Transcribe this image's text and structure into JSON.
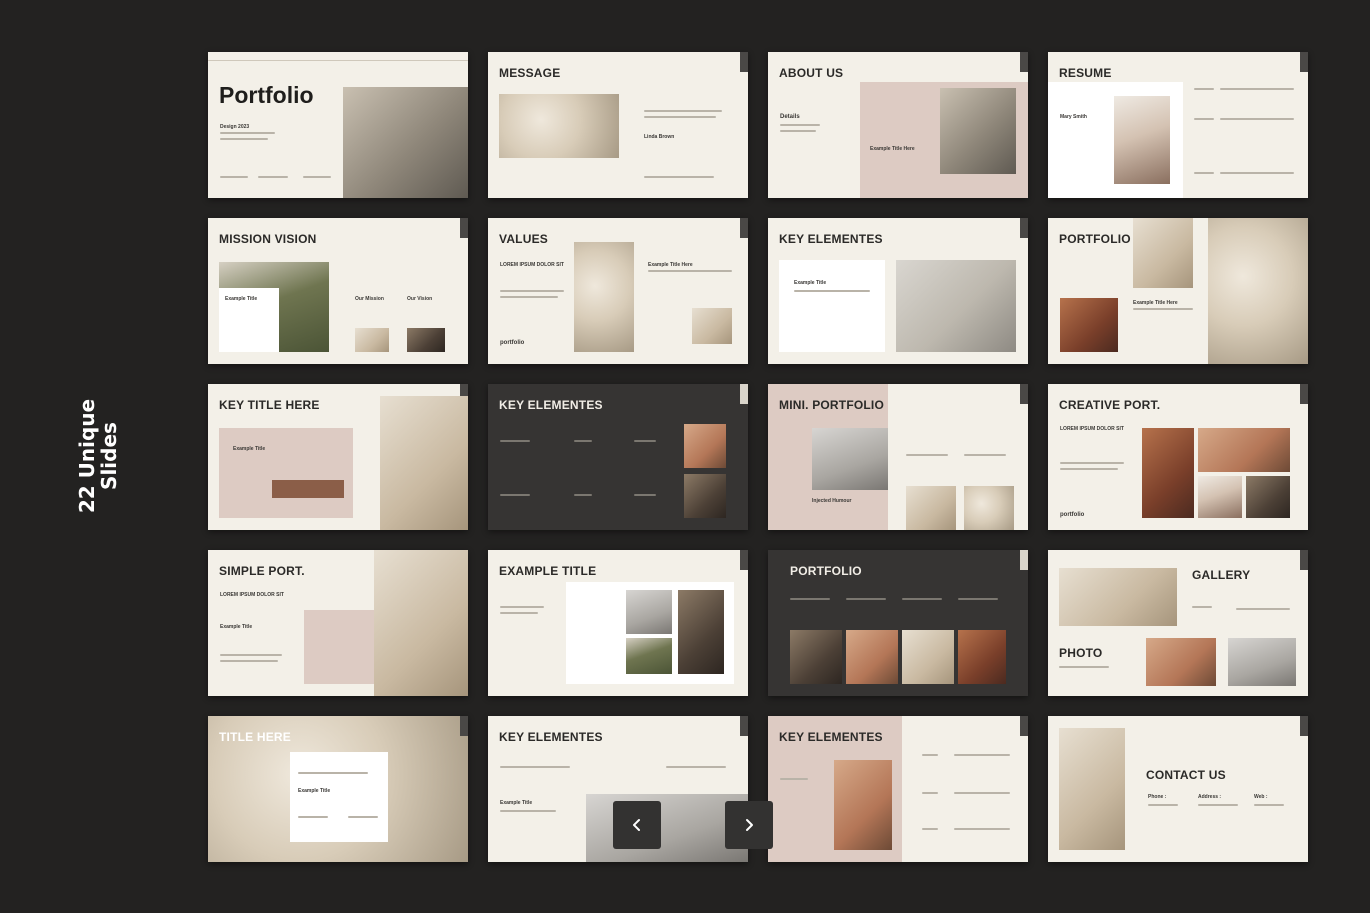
{
  "caption": {
    "line1": "22 Unique",
    "line2": "Slides"
  },
  "slides": [
    {
      "title": "Portfolio",
      "sub": "Design 2023"
    },
    {
      "title": "MESSAGE",
      "name": "Linda Brown"
    },
    {
      "title": "ABOUT US",
      "sub": "Details",
      "tag": "Example Title Here"
    },
    {
      "title": "RESUME",
      "name": "Mary Smith"
    },
    {
      "title": "MISSION VISION",
      "tag": "Example Title",
      "col1": "Our Mission",
      "col2": "Our Vision"
    },
    {
      "title": "VALUES",
      "sub": "LOREM IPSUM DOLOR SIT",
      "tag": "Example Title Here",
      "brand": "portfolio"
    },
    {
      "title": "KEY ELEMENTES",
      "tag": "Example Title"
    },
    {
      "title": "PORTFOLIO",
      "tag": "Example Title Here"
    },
    {
      "title": "KEY TITLE HERE",
      "tag": "Example Title"
    },
    {
      "title": "KEY ELEMENTES"
    },
    {
      "title": "MINI. PORTFOLIO",
      "tag": "Injected Humour"
    },
    {
      "title": "CREATIVE PORT.",
      "sub": "LOREM IPSUM DOLOR SIT",
      "brand": "portfolio"
    },
    {
      "title": "SIMPLE PORT.",
      "sub": "LOREM IPSUM DOLOR SIT",
      "tag": "Example Title"
    },
    {
      "title": "EXAMPLE TITLE"
    },
    {
      "title": "PORTFOLIO"
    },
    {
      "title": "GALLERY",
      "sub": "PHOTO"
    },
    {
      "title": "TITLE HERE",
      "tag": "Example Title"
    },
    {
      "title": "KEY ELEMENTES",
      "tag": "Example Title"
    },
    {
      "title": "KEY ELEMENTES"
    },
    {
      "title": "CONTACT US",
      "phone": "Phone :",
      "address": "Address :",
      "web": "Web :"
    }
  ],
  "nav": {
    "prev_icon": "chevron-left-icon",
    "next_icon": "chevron-right-icon"
  },
  "colors": {
    "background": "#232221",
    "slide_light": "#f3f0e8",
    "slide_dark": "#363433",
    "accent_pink": "#ddcbc3"
  }
}
